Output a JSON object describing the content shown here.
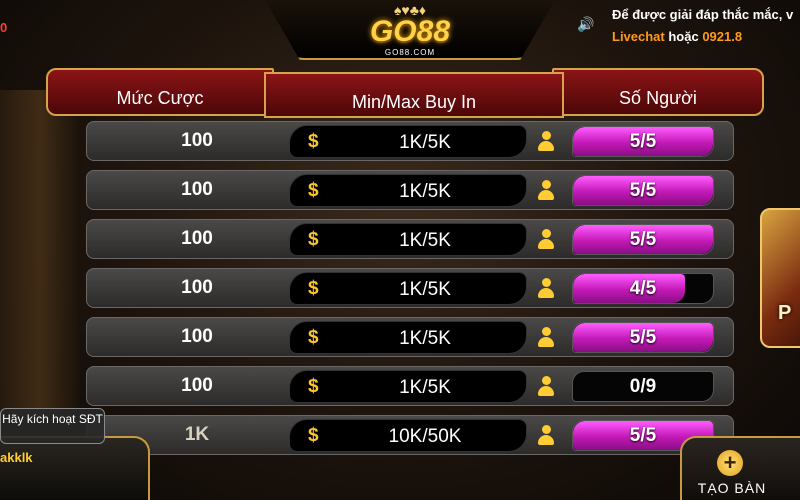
{
  "top": {
    "left_value": "0",
    "logo_brand": "GO88",
    "logo_domain": "GO88.COM",
    "support_line1": "Để được giải đáp thắc mắc, v",
    "support_livechat": "Livechat",
    "support_or": " hoặc ",
    "support_phone": "0921.8"
  },
  "columns": {
    "stake": "Mức Cược",
    "buyin": "Min/Max Buy In",
    "players": "Số Người"
  },
  "rows": [
    {
      "stake": "100",
      "currency": "$",
      "range": "1K/5K",
      "seats": "5/5",
      "fill": 1.0
    },
    {
      "stake": "100",
      "currency": "$",
      "range": "1K/5K",
      "seats": "5/5",
      "fill": 1.0
    },
    {
      "stake": "100",
      "currency": "$",
      "range": "1K/5K",
      "seats": "5/5",
      "fill": 1.0
    },
    {
      "stake": "100",
      "currency": "$",
      "range": "1K/5K",
      "seats": "4/5",
      "fill": 0.8
    },
    {
      "stake": "100",
      "currency": "$",
      "range": "1K/5K",
      "seats": "5/5",
      "fill": 1.0
    },
    {
      "stake": "100",
      "currency": "$",
      "range": "1K/5K",
      "seats": "0/9",
      "fill": 0.0
    },
    {
      "stake": "1K",
      "currency": "$",
      "range": "10K/50K",
      "seats": "5/5",
      "fill": 1.0
    }
  ],
  "user": {
    "activate_label": "Hãy kích hoạt SĐT",
    "name": "akklk"
  },
  "create_button": {
    "label": "TẠO BÀN"
  },
  "colors": {
    "accent_gold": "#ffcc33",
    "seat_fill_magenta": "#c219b6",
    "header_red": "#8b1416"
  }
}
